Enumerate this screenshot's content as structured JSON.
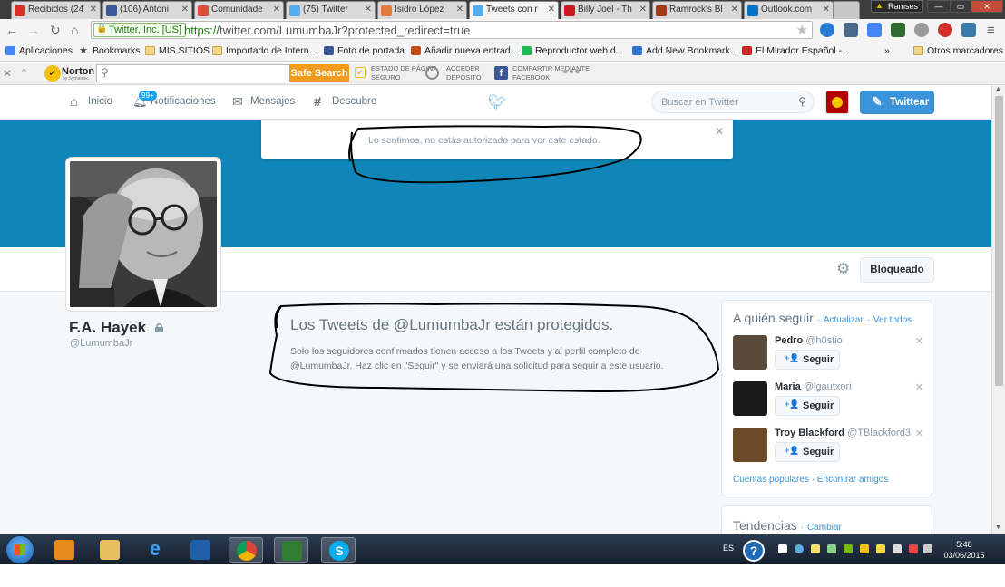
{
  "browser": {
    "tabs": [
      {
        "title": "Recibidos (24",
        "color": "#d93025",
        "active": false
      },
      {
        "title": "(106) Antoni",
        "color": "#3b5998",
        "active": false
      },
      {
        "title": "Comunidade",
        "color": "#dd4b39",
        "active": false
      },
      {
        "title": "(75) Twitter",
        "color": "#55acee",
        "active": false
      },
      {
        "title": "Isidro López",
        "color": "#e07b39",
        "active": false
      },
      {
        "title": "Tweets con r",
        "color": "#55acee",
        "active": true
      },
      {
        "title": "Billy Joel - Th",
        "color": "#cc181e",
        "active": false
      },
      {
        "title": "Ramrock's Bl",
        "color": "#a33a1c",
        "active": false
      },
      {
        "title": "Outlook.com",
        "color": "#0072c6",
        "active": false
      }
    ],
    "user": "Ramses",
    "ssl_label": "Twitter, Inc. [US]",
    "url_scheme": "https://",
    "url_rest": "twitter.com/LumumbaJr?protected_redirect=true",
    "bookmarks": [
      {
        "label": "Aplicaciones",
        "icon": "apps-grid-icon"
      },
      {
        "label": "Bookmarks",
        "icon": "star-icon"
      },
      {
        "label": "MIS SITIOS",
        "icon": "folder-icon"
      },
      {
        "label": "Importado de Intern...",
        "icon": "folder-icon"
      },
      {
        "label": "Foto de portada",
        "icon": "facebook-icon"
      },
      {
        "label": "Añadir nueva entrad...",
        "icon": "blogger-icon"
      },
      {
        "label": "Reproductor web d...",
        "icon": "spotify-icon"
      },
      {
        "label": "Add New Bookmark...",
        "icon": "delicious-icon"
      },
      {
        "label": "El Mirador Español -...",
        "icon": "mirador-icon"
      }
    ],
    "bookmarks_more": "»",
    "other_bookmarks": "Otros marcadores"
  },
  "norton": {
    "brand": "Norton",
    "brand_sub": "by Symantec",
    "safe_search": "Safe Search",
    "page_state_1": "ESTADO DE PÁGINA",
    "page_state_2": "SEGURO",
    "deposit_1": "ACCEDER",
    "deposit_2": "DEPÓSITO",
    "share_1": "COMPARTIR MEDIANTE",
    "share_2": "FACEBOOK"
  },
  "twitter": {
    "nav": {
      "home": "Inicio",
      "notifications": "Notificaciones",
      "notifications_badge": "99+",
      "messages": "Mensajes",
      "discover": "Descubre"
    },
    "search_placeholder": "Buscar en Twitter",
    "tweet_button": "Twittear",
    "alert_message": "Lo sentimos, no estás autorizado para ver este estado.",
    "blocked_button": "Bloqueado",
    "profile": {
      "name": "F.A. Hayek",
      "handle": "@LumumbaJr"
    },
    "protected": {
      "title": "Los Tweets de @LumumbaJr están protegidos.",
      "text": "Solo los seguidores confirmados tienen acceso a los Tweets y al perfil completo de @LumumbaJr. Haz clic en \"Seguir\" y se enviará una solicitud para seguir a este usuario."
    },
    "who_to_follow": {
      "title": "A quién seguir",
      "refresh": "Actualizar",
      "view_all": "Ver todos",
      "sep": "·",
      "users": [
        {
          "name": "Pedro",
          "handle": "@h0stio",
          "follow": "Seguir",
          "color": "#5a4a3a"
        },
        {
          "name": "Maria",
          "handle": "@lgautxori",
          "follow": "Seguir",
          "color": "#1a1a1a"
        },
        {
          "name": "Troy Blackford",
          "handle": "@TBlackford3",
          "follow": "Seguir",
          "color": "#6b4a2a"
        }
      ],
      "popular": "Cuentas populares",
      "find_friends": "Encontrar amigos"
    },
    "trends": {
      "title": "Tendencias",
      "change": "Cambiar"
    }
  },
  "taskbar": {
    "lang": "ES",
    "help": "?",
    "time": "5:48",
    "date": "03/06/2015"
  }
}
